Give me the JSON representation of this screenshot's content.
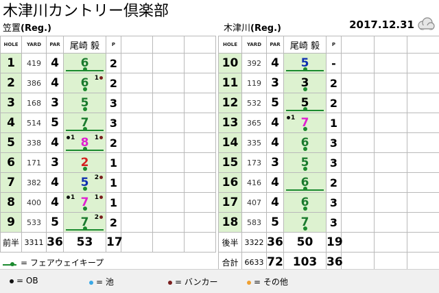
{
  "title": "木津川カントリー倶楽部",
  "date": "2017.12.31",
  "weather_icon": "cloudy-icon",
  "colors": {
    "fairway": "#1b8a2e",
    "cell_green": "#ddf2d0",
    "ob": "#111111",
    "pond": "#3aa8e6",
    "bunker": "#7a1f1f",
    "other": "#f0a030"
  },
  "header_labels": {
    "hole": "HOLE",
    "yard": "YARD",
    "par": "PAR",
    "player": "尾崎 毅",
    "putt": "P"
  },
  "front": {
    "course": "笠置",
    "reg": "(Reg.)",
    "holes": [
      {
        "hole": "1",
        "yard": "419",
        "par": "4",
        "score": "6",
        "putt": "2",
        "color": "#1b7a2e",
        "fw": true,
        "left": "",
        "right": ""
      },
      {
        "hole": "2",
        "yard": "386",
        "par": "4",
        "score": "6",
        "putt": "2",
        "color": "#1b7a2e",
        "fw": false,
        "left": "",
        "right": "1"
      },
      {
        "hole": "3",
        "yard": "168",
        "par": "3",
        "score": "5",
        "putt": "3",
        "color": "#1b7a2e",
        "fw": false,
        "left": "",
        "right": ""
      },
      {
        "hole": "4",
        "yard": "514",
        "par": "5",
        "score": "7",
        "putt": "3",
        "color": "#1b7a2e",
        "fw": true,
        "left": "",
        "right": ""
      },
      {
        "hole": "5",
        "yard": "338",
        "par": "4",
        "score": "8",
        "putt": "2",
        "color": "#e020d0",
        "fw": true,
        "left": "1",
        "right": "1"
      },
      {
        "hole": "6",
        "yard": "171",
        "par": "3",
        "score": "2",
        "putt": "1",
        "color": "#d42020",
        "fw": false,
        "left": "",
        "right": ""
      },
      {
        "hole": "7",
        "yard": "382",
        "par": "4",
        "score": "5",
        "putt": "1",
        "color": "#1030b0",
        "fw": false,
        "left": "",
        "right": "2"
      },
      {
        "hole": "8",
        "yard": "400",
        "par": "4",
        "score": "7",
        "putt": "1",
        "color": "#e020d0",
        "fw": false,
        "left": "1",
        "right": "1"
      },
      {
        "hole": "9",
        "yard": "533",
        "par": "5",
        "score": "7",
        "putt": "2",
        "color": "#1b7a2e",
        "fw": true,
        "left": "",
        "right": "2"
      }
    ],
    "total": {
      "label": "前半",
      "yard": "3311",
      "par": "36",
      "score": "53",
      "putt": "17"
    }
  },
  "back": {
    "course": "木津川",
    "reg": "(Reg.)",
    "holes": [
      {
        "hole": "10",
        "yard": "392",
        "par": "4",
        "score": "5",
        "putt": "-",
        "color": "#1030b0",
        "fw": true,
        "left": "",
        "right": ""
      },
      {
        "hole": "11",
        "yard": "119",
        "par": "3",
        "score": "3",
        "putt": "2",
        "color": "#000000",
        "fw": false,
        "left": "",
        "right": ""
      },
      {
        "hole": "12",
        "yard": "532",
        "par": "5",
        "score": "5",
        "putt": "2",
        "color": "#000000",
        "fw": true,
        "left": "",
        "right": ""
      },
      {
        "hole": "13",
        "yard": "365",
        "par": "4",
        "score": "7",
        "putt": "1",
        "color": "#e020d0",
        "fw": false,
        "left": "1",
        "right": ""
      },
      {
        "hole": "14",
        "yard": "335",
        "par": "4",
        "score": "6",
        "putt": "3",
        "color": "#1b7a2e",
        "fw": false,
        "left": "",
        "right": ""
      },
      {
        "hole": "15",
        "yard": "173",
        "par": "3",
        "score": "5",
        "putt": "3",
        "color": "#1b7a2e",
        "fw": false,
        "left": "",
        "right": ""
      },
      {
        "hole": "16",
        "yard": "416",
        "par": "4",
        "score": "6",
        "putt": "2",
        "color": "#1b7a2e",
        "fw": true,
        "left": "",
        "right": ""
      },
      {
        "hole": "17",
        "yard": "407",
        "par": "4",
        "score": "6",
        "putt": "3",
        "color": "#1b7a2e",
        "fw": false,
        "left": "",
        "right": ""
      },
      {
        "hole": "18",
        "yard": "583",
        "par": "5",
        "score": "7",
        "putt": "3",
        "color": "#1b7a2e",
        "fw": false,
        "left": "",
        "right": ""
      }
    ],
    "total": {
      "label": "後半",
      "yard": "3322",
      "par": "36",
      "score": "50",
      "putt": "19"
    },
    "grand": {
      "label": "合計",
      "yard": "6633",
      "par": "72",
      "score": "103",
      "putt": "36"
    }
  },
  "legend": {
    "fairway": "= フェアウェイキープ",
    "ob": "= OB",
    "pond": "= 池",
    "bunker": "= バンカー",
    "other": "= その他"
  }
}
